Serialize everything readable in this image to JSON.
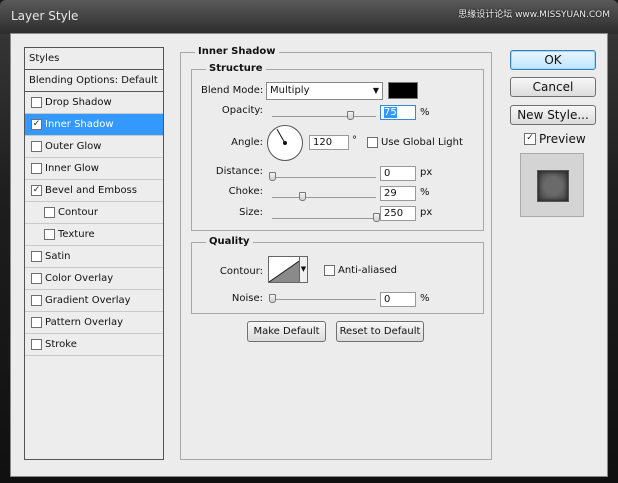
{
  "window": {
    "title": "Layer Style",
    "watermark": "思缘设计论坛 www.MISSYUAN.COM"
  },
  "styles_list": {
    "items": [
      {
        "label": "Styles",
        "type": "header",
        "checked": null,
        "selected": false
      },
      {
        "label": "Blending Options: Default",
        "type": "header",
        "checked": null,
        "selected": false
      },
      {
        "label": "Drop Shadow",
        "type": "item",
        "checked": false,
        "selected": false
      },
      {
        "label": "Inner Shadow",
        "type": "item",
        "checked": true,
        "selected": true
      },
      {
        "label": "Outer Glow",
        "type": "item",
        "checked": false,
        "selected": false
      },
      {
        "label": "Inner Glow",
        "type": "item",
        "checked": false,
        "selected": false
      },
      {
        "label": "Bevel and Emboss",
        "type": "item",
        "checked": true,
        "selected": false
      },
      {
        "label": "Contour",
        "type": "sub",
        "checked": false,
        "selected": false
      },
      {
        "label": "Texture",
        "type": "sub",
        "checked": false,
        "selected": false
      },
      {
        "label": "Satin",
        "type": "item",
        "checked": false,
        "selected": false
      },
      {
        "label": "Color Overlay",
        "type": "item",
        "checked": false,
        "selected": false
      },
      {
        "label": "Gradient Overlay",
        "type": "item",
        "checked": false,
        "selected": false
      },
      {
        "label": "Pattern Overlay",
        "type": "item",
        "checked": false,
        "selected": false
      },
      {
        "label": "Stroke",
        "type": "item",
        "checked": false,
        "selected": false
      }
    ]
  },
  "panel": {
    "title": "Inner Shadow",
    "structure": {
      "title": "Structure",
      "blend_mode": {
        "label": "Blend Mode:",
        "value": "Multiply",
        "color": "#000000"
      },
      "opacity": {
        "label": "Opacity:",
        "value": "75",
        "unit": "%",
        "slider_fraction": 0.75
      },
      "angle": {
        "label": "Angle:",
        "value": "120",
        "unit": "°",
        "degrees": 120,
        "global_light_label": "Use Global Light",
        "global_light_checked": false
      },
      "distance": {
        "label": "Distance:",
        "value": "0",
        "unit": "px",
        "slider_fraction": 0.0
      },
      "choke": {
        "label": "Choke:",
        "value": "29",
        "unit": "%",
        "slider_fraction": 0.29
      },
      "size": {
        "label": "Size:",
        "value": "250",
        "unit": "px",
        "slider_fraction": 1.0
      }
    },
    "quality": {
      "title": "Quality",
      "contour": {
        "label": "Contour:",
        "anti_aliased_label": "Anti-aliased",
        "anti_aliased_checked": false
      },
      "noise": {
        "label": "Noise:",
        "value": "0",
        "unit": "%",
        "slider_fraction": 0.0
      }
    },
    "make_default_label": "Make Default",
    "reset_default_label": "Reset to Default"
  },
  "buttons": {
    "ok_label": "OK",
    "cancel_label": "Cancel",
    "new_style_label": "New Style...",
    "preview_label": "Preview",
    "preview_checked": true
  }
}
